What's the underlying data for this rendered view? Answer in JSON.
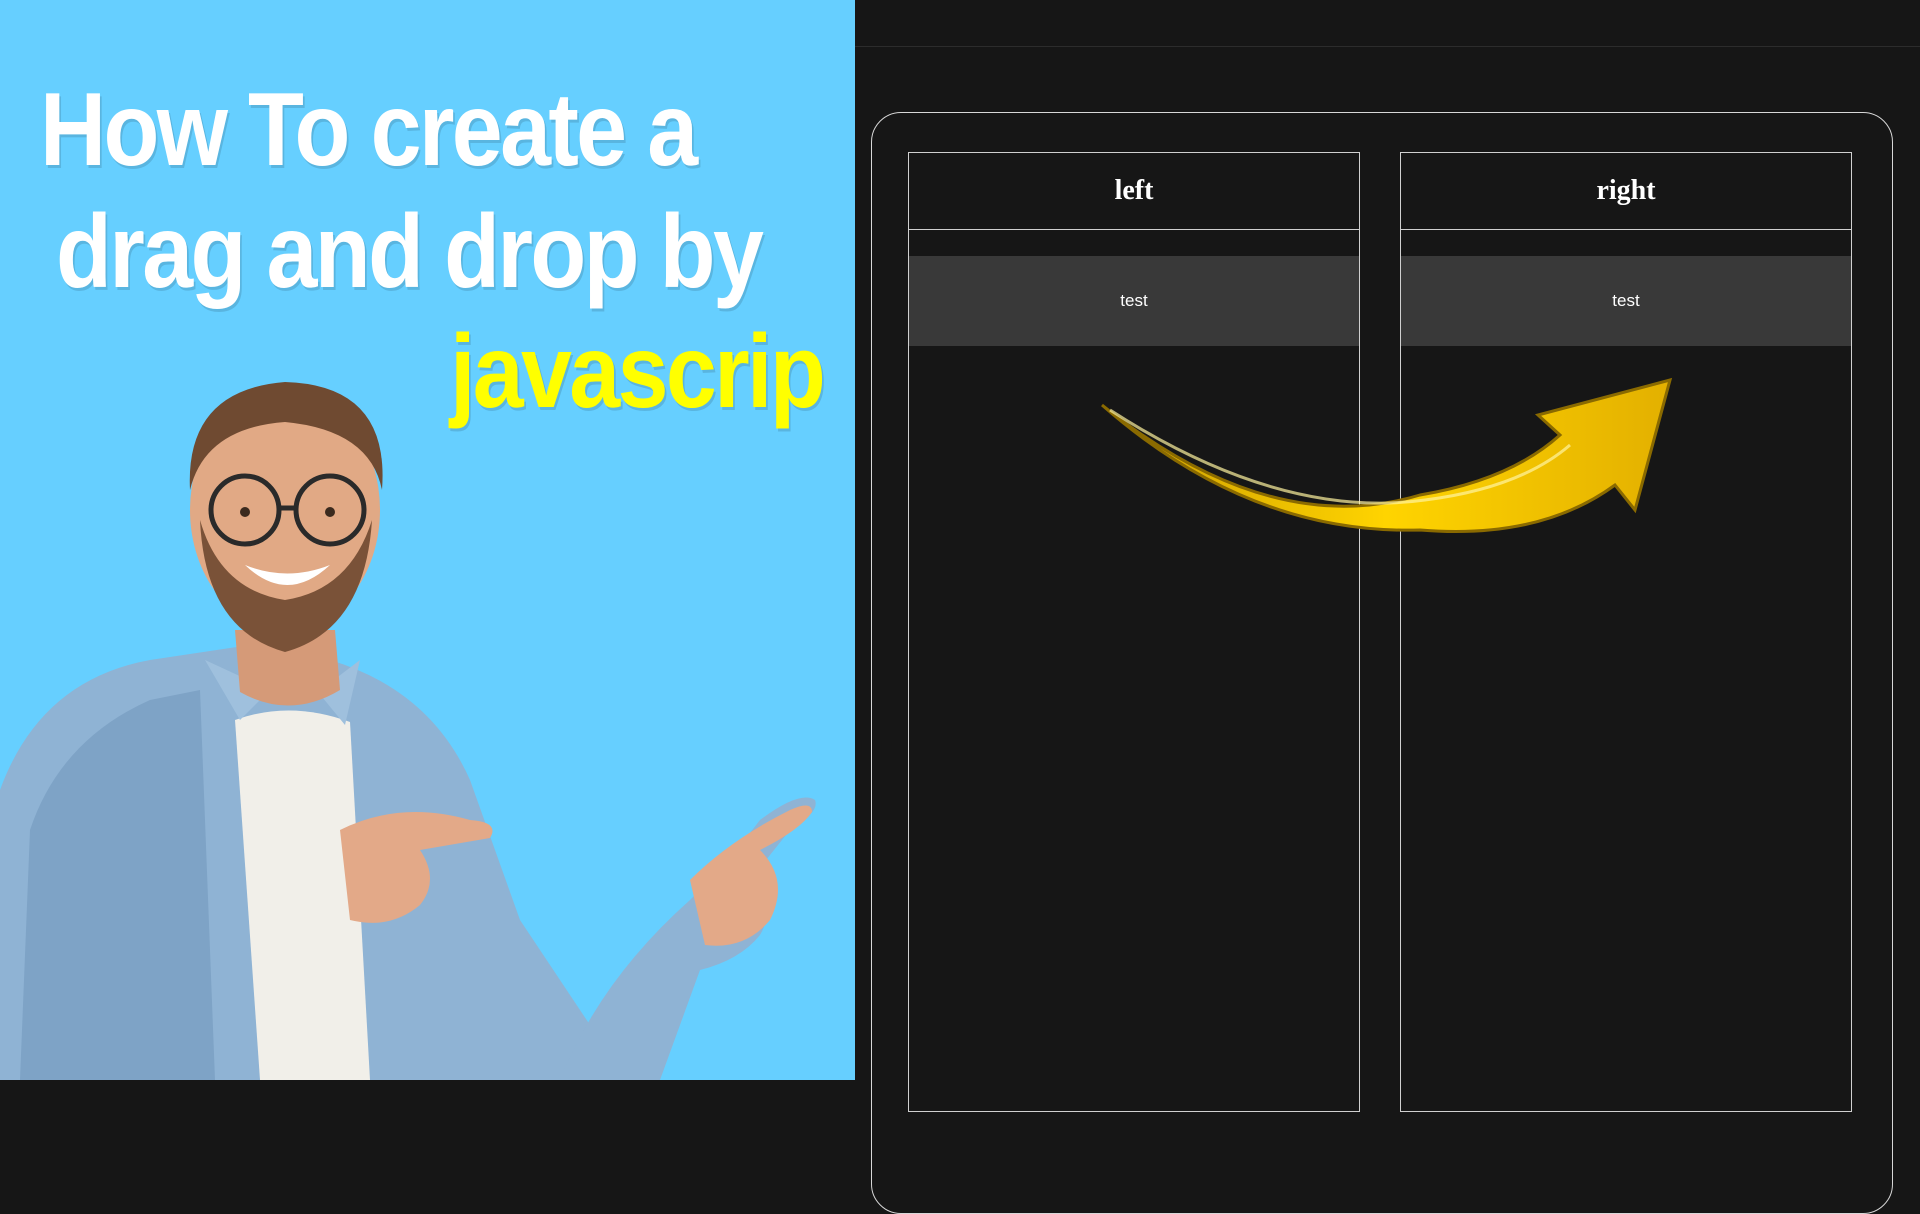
{
  "headline": {
    "line1": "How To create a",
    "line2": "drag and drop by",
    "line3": "javascrip"
  },
  "colors": {
    "promo_background": "#66cfff",
    "headline_white": "#ffffff",
    "headline_accent": "#ffff00",
    "app_background": "#161616",
    "card_background": "#393939",
    "arrow_gold": "#e8b800"
  },
  "board": {
    "columns": [
      {
        "title": "left",
        "cards": [
          "test"
        ]
      },
      {
        "title": "right",
        "cards": [
          "test"
        ]
      }
    ]
  },
  "decorations": {
    "person": "pointing-man-illustration",
    "arrow": "gold-curved-arrow-icon"
  }
}
